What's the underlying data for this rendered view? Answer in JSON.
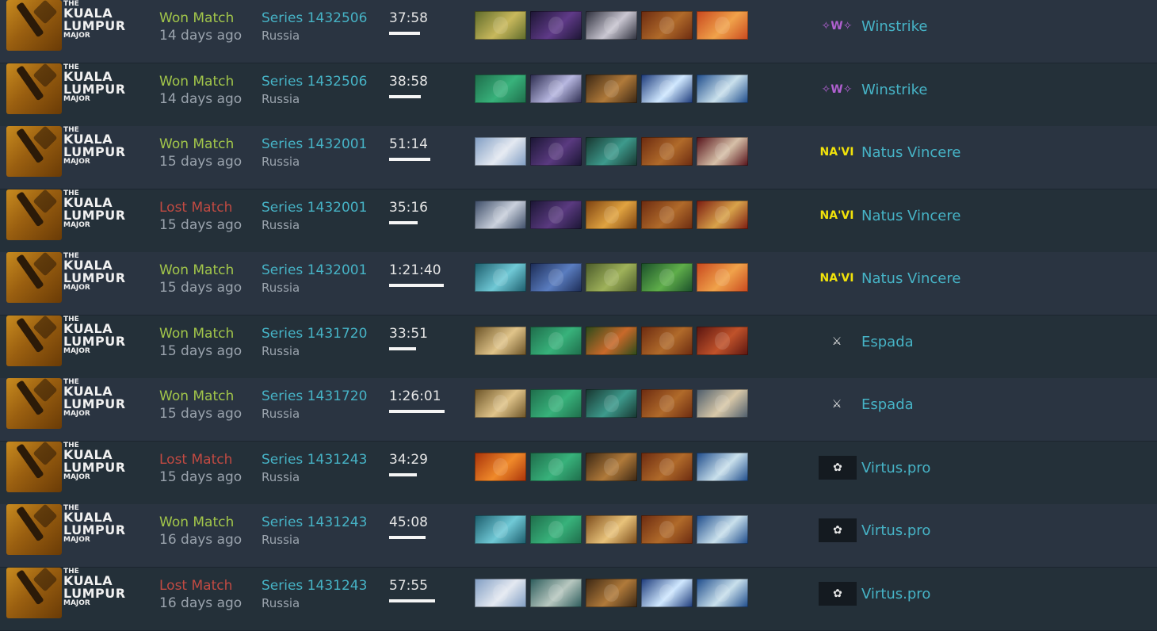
{
  "league": {
    "logo_lines": [
      "THE",
      "KUALA",
      "LUMPUR",
      "MAJOR"
    ]
  },
  "matches": [
    {
      "result": "Won Match",
      "result_type": "won",
      "time_ago": "14 days ago",
      "series": "Series 1432506",
      "region": "Russia",
      "duration": "37:58",
      "duration_fraction": 0.44,
      "heroes": [
        {
          "name": "hero-icon",
          "colors": [
            "#5d6a2a",
            "#c8b85c"
          ]
        },
        {
          "name": "hero-icon",
          "colors": [
            "#1c1533",
            "#5f3a88"
          ]
        },
        {
          "name": "hero-icon",
          "colors": [
            "#2b2d3a",
            "#c9c6d1"
          ]
        },
        {
          "name": "hero-icon",
          "colors": [
            "#6b2a10",
            "#b06a2a"
          ]
        },
        {
          "name": "hero-icon",
          "colors": [
            "#c8471e",
            "#f0a24a"
          ]
        }
      ],
      "team": {
        "name": "Winstrike",
        "icon": "winstrike-logo-icon",
        "glyph": "✧W✧",
        "style": "winstrike"
      }
    },
    {
      "result": "Won Match",
      "result_type": "won",
      "time_ago": "14 days ago",
      "series": "Series 1432506",
      "region": "Russia",
      "duration": "38:58",
      "duration_fraction": 0.45,
      "heroes": [
        {
          "name": "hero-icon",
          "colors": [
            "#1e6c4a",
            "#38b27b"
          ]
        },
        {
          "name": "hero-icon",
          "colors": [
            "#2a2a4d",
            "#b7b7e0"
          ]
        },
        {
          "name": "hero-icon",
          "colors": [
            "#3a2613",
            "#b07a3a"
          ]
        },
        {
          "name": "hero-icon",
          "colors": [
            "#1a3878",
            "#d0e8ff"
          ]
        },
        {
          "name": "hero-icon",
          "colors": [
            "#1c4a8a",
            "#c9e0ec"
          ]
        }
      ],
      "team": {
        "name": "Winstrike",
        "icon": "winstrike-logo-icon",
        "glyph": "✧W✧",
        "style": "winstrike"
      }
    },
    {
      "result": "Won Match",
      "result_type": "won",
      "time_ago": "15 days ago",
      "series": "Series 1432001",
      "region": "Russia",
      "duration": "51:14",
      "duration_fraction": 0.59,
      "heroes": [
        {
          "name": "hero-icon",
          "colors": [
            "#7f9cc2",
            "#e4e9f1"
          ]
        },
        {
          "name": "hero-icon",
          "colors": [
            "#1a1533",
            "#5a3a80"
          ]
        },
        {
          "name": "hero-icon",
          "colors": [
            "#17352f",
            "#3d9a8c"
          ]
        },
        {
          "name": "hero-icon",
          "colors": [
            "#6b2a10",
            "#b06a2a"
          ]
        },
        {
          "name": "hero-icon",
          "colors": [
            "#541018",
            "#d6c0a8"
          ]
        }
      ],
      "team": {
        "name": "Natus Vincere",
        "icon": "natus-vincere-logo-icon",
        "glyph": "NA'VI",
        "style": "navi"
      }
    },
    {
      "result": "Lost Match",
      "result_type": "lost",
      "time_ago": "15 days ago",
      "series": "Series 1432001",
      "region": "Russia",
      "duration": "35:16",
      "duration_fraction": 0.41,
      "heroes": [
        {
          "name": "hero-icon",
          "colors": [
            "#3b4b66",
            "#c9d0dc"
          ]
        },
        {
          "name": "hero-icon",
          "colors": [
            "#1a1533",
            "#5a3a80"
          ]
        },
        {
          "name": "hero-icon",
          "colors": [
            "#7b4010",
            "#e0a340"
          ]
        },
        {
          "name": "hero-icon",
          "colors": [
            "#6b2a10",
            "#b06a2a"
          ]
        },
        {
          "name": "hero-icon",
          "colors": [
            "#7a1a10",
            "#d8a24a"
          ]
        }
      ],
      "team": {
        "name": "Natus Vincere",
        "icon": "natus-vincere-logo-icon",
        "glyph": "NA'VI",
        "style": "navi"
      }
    },
    {
      "result": "Won Match",
      "result_type": "won",
      "time_ago": "15 days ago",
      "series": "Series 1432001",
      "region": "Russia",
      "duration": "1:21:40",
      "duration_fraction": 0.78,
      "heroes": [
        {
          "name": "hero-icon",
          "colors": [
            "#1b5b6a",
            "#70c9d6"
          ]
        },
        {
          "name": "hero-icon",
          "colors": [
            "#1b2b55",
            "#5a7dc0"
          ]
        },
        {
          "name": "hero-icon",
          "colors": [
            "#4a5a2a",
            "#9fb25a"
          ]
        },
        {
          "name": "hero-icon",
          "colors": [
            "#1a4f2a",
            "#5fae4a"
          ]
        },
        {
          "name": "hero-icon",
          "colors": [
            "#c8471e",
            "#f0a24a"
          ]
        }
      ],
      "team": {
        "name": "Natus Vincere",
        "icon": "natus-vincere-logo-icon",
        "glyph": "NA'VI",
        "style": "navi"
      }
    },
    {
      "result": "Won Match",
      "result_type": "won",
      "time_ago": "15 days ago",
      "series": "Series 1431720",
      "region": "Russia",
      "duration": "33:51",
      "duration_fraction": 0.39,
      "heroes": [
        {
          "name": "hero-icon",
          "colors": [
            "#6a5226",
            "#e0c48a"
          ]
        },
        {
          "name": "hero-icon",
          "colors": [
            "#1e6c4a",
            "#38b27b"
          ]
        },
        {
          "name": "hero-icon",
          "colors": [
            "#2a4a1a",
            "#c8692a"
          ]
        },
        {
          "name": "hero-icon",
          "colors": [
            "#6b2a10",
            "#b06a2a"
          ]
        },
        {
          "name": "hero-icon",
          "colors": [
            "#5a1510",
            "#c0522a"
          ]
        }
      ],
      "team": {
        "name": "Espada",
        "icon": "espada-logo-icon",
        "glyph": "⚔",
        "style": "espada"
      }
    },
    {
      "result": "Won Match",
      "result_type": "won",
      "time_ago": "15 days ago",
      "series": "Series 1431720",
      "region": "Russia",
      "duration": "1:26:01",
      "duration_fraction": 0.8,
      "heroes": [
        {
          "name": "hero-icon",
          "colors": [
            "#6a5226",
            "#e0c48a"
          ]
        },
        {
          "name": "hero-icon",
          "colors": [
            "#1e6c4a",
            "#38b27b"
          ]
        },
        {
          "name": "hero-icon",
          "colors": [
            "#17352f",
            "#3d9a8c"
          ]
        },
        {
          "name": "hero-icon",
          "colors": [
            "#6b2a10",
            "#b06a2a"
          ]
        },
        {
          "name": "hero-icon",
          "colors": [
            "#4a5a6a",
            "#d8c8a8"
          ]
        }
      ],
      "team": {
        "name": "Espada",
        "icon": "espada-logo-icon",
        "glyph": "⚔",
        "style": "espada"
      }
    },
    {
      "result": "Lost Match",
      "result_type": "lost",
      "time_ago": "15 days ago",
      "series": "Series 1431243",
      "region": "Russia",
      "duration": "34:29",
      "duration_fraction": 0.4,
      "heroes": [
        {
          "name": "hero-icon",
          "colors": [
            "#a8320a",
            "#f08a2a"
          ]
        },
        {
          "name": "hero-icon",
          "colors": [
            "#1e6c4a",
            "#38b27b"
          ]
        },
        {
          "name": "hero-icon",
          "colors": [
            "#3a2613",
            "#b07a3a"
          ]
        },
        {
          "name": "hero-icon",
          "colors": [
            "#6b2a10",
            "#b06a2a"
          ]
        },
        {
          "name": "hero-icon",
          "colors": [
            "#1c4a8a",
            "#c9e0ec"
          ]
        }
      ],
      "team": {
        "name": "Virtus.pro",
        "icon": "virtus-pro-logo-icon",
        "glyph": "✿",
        "style": "vp"
      }
    },
    {
      "result": "Won Match",
      "result_type": "won",
      "time_ago": "16 days ago",
      "series": "Series 1431243",
      "region": "Russia",
      "duration": "45:08",
      "duration_fraction": 0.52,
      "heroes": [
        {
          "name": "hero-icon",
          "colors": [
            "#1b5b6a",
            "#70c9d6"
          ]
        },
        {
          "name": "hero-icon",
          "colors": [
            "#1e6c4a",
            "#38b27b"
          ]
        },
        {
          "name": "hero-icon",
          "colors": [
            "#7a4a1a",
            "#e8c27a"
          ]
        },
        {
          "name": "hero-icon",
          "colors": [
            "#6b2a10",
            "#b06a2a"
          ]
        },
        {
          "name": "hero-icon",
          "colors": [
            "#1c4a8a",
            "#c9e0ec"
          ]
        }
      ],
      "team": {
        "name": "Virtus.pro",
        "icon": "virtus-pro-logo-icon",
        "glyph": "✿",
        "style": "vp"
      }
    },
    {
      "result": "Lost Match",
      "result_type": "lost",
      "time_ago": "16 days ago",
      "series": "Series 1431243",
      "region": "Russia",
      "duration": "57:55",
      "duration_fraction": 0.66,
      "heroes": [
        {
          "name": "hero-icon",
          "colors": [
            "#7f9cc2",
            "#e4e9f1"
          ]
        },
        {
          "name": "hero-icon",
          "colors": [
            "#2a5a5a",
            "#b8c8c0"
          ]
        },
        {
          "name": "hero-icon",
          "colors": [
            "#3a2613",
            "#b07a3a"
          ]
        },
        {
          "name": "hero-icon",
          "colors": [
            "#1a3878",
            "#d0e8ff"
          ]
        },
        {
          "name": "hero-icon",
          "colors": [
            "#1c4a8a",
            "#c9e0ec"
          ]
        }
      ],
      "team": {
        "name": "Virtus.pro",
        "icon": "virtus-pro-logo-icon",
        "glyph": "✿",
        "style": "vp"
      }
    }
  ]
}
